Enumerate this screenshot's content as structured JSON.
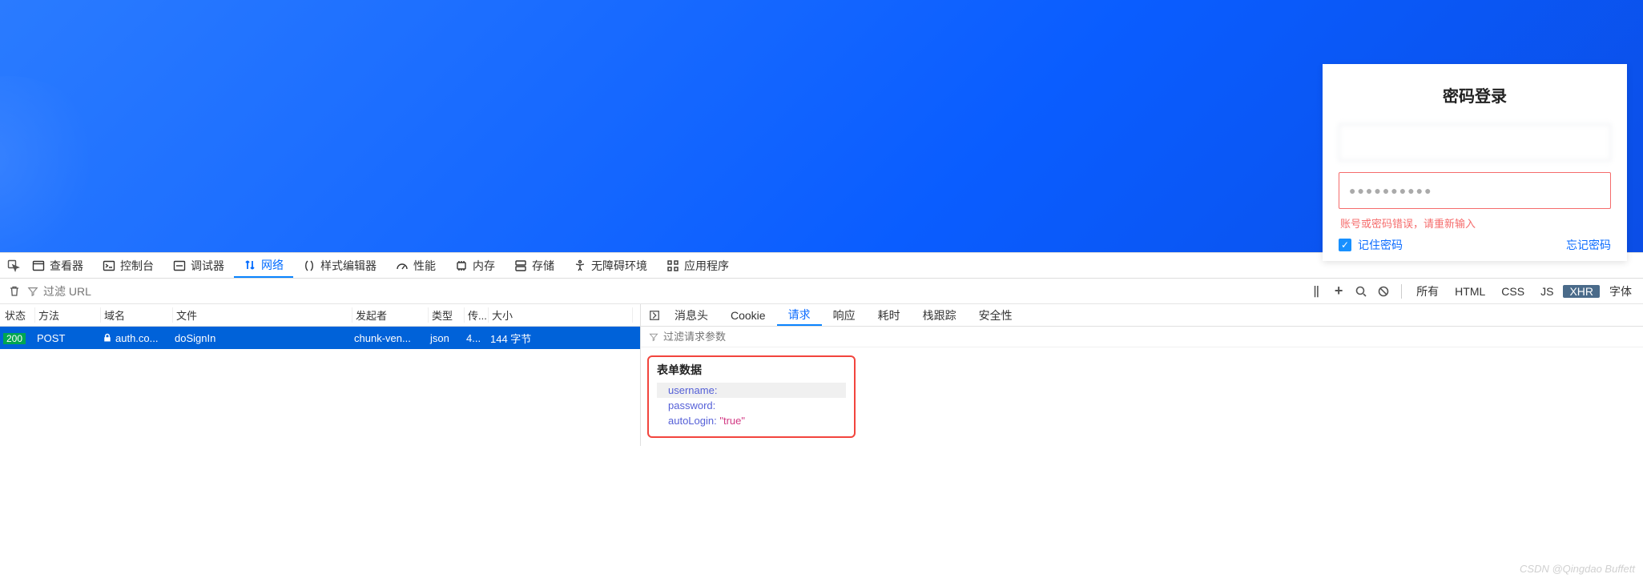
{
  "login": {
    "title": "密码登录",
    "username_value": "",
    "password_mask": "●●●●●●●●●●",
    "error_msg": "账号或密码错误，请重新输入",
    "remember_label": "记住密码",
    "remember_checked": true,
    "forgot_label": "忘记密码"
  },
  "devtools_tabs": [
    {
      "icon": "inspector",
      "label": "查看器"
    },
    {
      "icon": "console",
      "label": "控制台"
    },
    {
      "icon": "debugger",
      "label": "调试器"
    },
    {
      "icon": "network",
      "label": "网络",
      "active": true
    },
    {
      "icon": "style",
      "label": "样式编辑器"
    },
    {
      "icon": "perf",
      "label": "性能"
    },
    {
      "icon": "memory",
      "label": "内存"
    },
    {
      "icon": "storage",
      "label": "存储"
    },
    {
      "icon": "a11y",
      "label": "无障碍环境"
    },
    {
      "icon": "apps",
      "label": "应用程序"
    }
  ],
  "toolbar": {
    "filter_placeholder": "过滤 URL",
    "type_filters": [
      "所有",
      "HTML",
      "CSS",
      "JS",
      "XHR",
      "字体"
    ],
    "active_type": "XHR"
  },
  "network": {
    "columns": [
      "状态",
      "方法",
      "域名",
      "文件",
      "发起者",
      "类型",
      "传...",
      "大小"
    ],
    "row": {
      "status": "200",
      "method": "POST",
      "domain": "auth.co...",
      "file": "doSignIn",
      "initiator": "chunk-ven...",
      "type": "json",
      "transferred": "4...",
      "size": "144 字节"
    }
  },
  "detail_tabs": [
    "消息头",
    "Cookie",
    "请求",
    "响应",
    "耗时",
    "栈跟踪",
    "安全性"
  ],
  "detail_active": "请求",
  "detail_filter_placeholder": "过滤请求参数",
  "form_data": {
    "title": "表单数据",
    "entries": [
      {
        "key": "username",
        "value": ""
      },
      {
        "key": "password",
        "value": ""
      },
      {
        "key": "autoLogin",
        "value": "\"true\""
      }
    ]
  },
  "watermark": "CSDN @Qingdao Buffett"
}
